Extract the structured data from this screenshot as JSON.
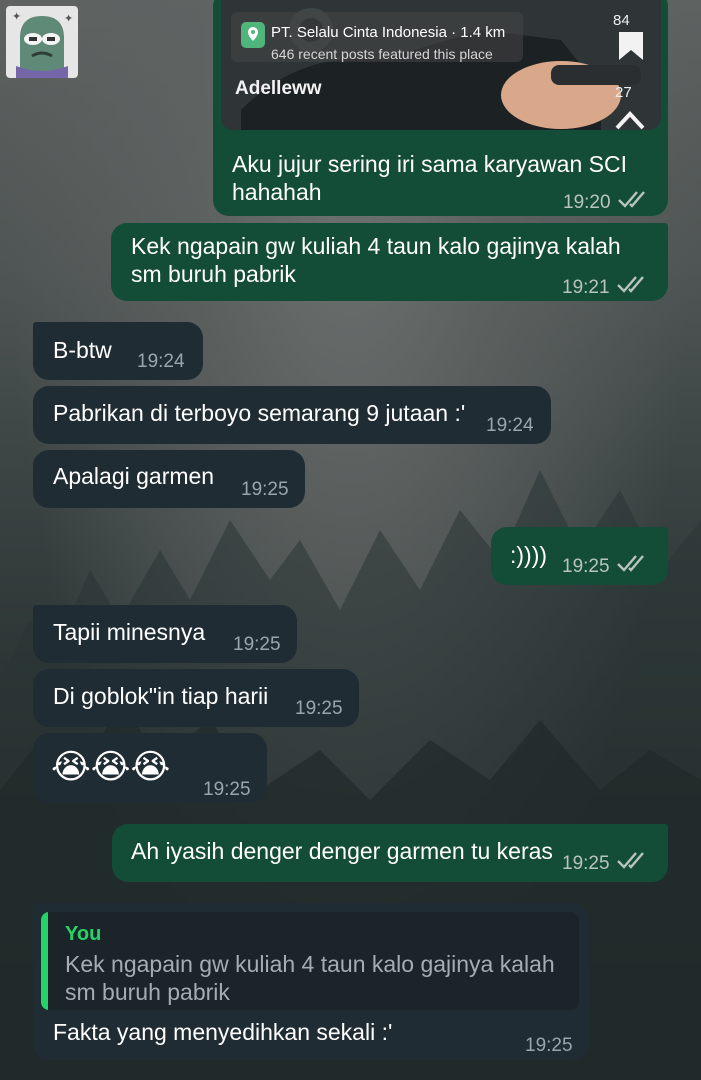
{
  "avatar": {
    "icon": "frog-sticker-icon"
  },
  "shared_post": {
    "place_name": "PT. Selalu Cinta Indonesia · 1.4 km",
    "place_sub": "646 recent posts featured this place",
    "username": "Adelleww",
    "share_count": "84",
    "save_count": "27"
  },
  "messages": [
    {
      "id": "m1",
      "direction": "out",
      "text_lines": [
        "Aku jujur sering iri sama karyawan SCI",
        "hahahah"
      ],
      "time": "19:20",
      "status": "read"
    },
    {
      "id": "m2",
      "direction": "out",
      "text_lines": [
        "Kek ngapain gw kuliah 4 taun kalo gajinya kalah",
        "sm buruh pabrik"
      ],
      "time": "19:21",
      "status": "read"
    },
    {
      "id": "m3",
      "direction": "in",
      "text": "B-btw",
      "time": "19:24"
    },
    {
      "id": "m4",
      "direction": "in",
      "text": "Pabrikan di terboyo semarang 9 jutaan :'",
      "time": "19:24"
    },
    {
      "id": "m5",
      "direction": "in",
      "text": "Apalagi garmen",
      "time": "19:25"
    },
    {
      "id": "m6",
      "direction": "out",
      "text": ":))))",
      "time": "19:25",
      "status": "read"
    },
    {
      "id": "m7",
      "direction": "in",
      "text": "Tapii minesnya",
      "time": "19:25"
    },
    {
      "id": "m8",
      "direction": "in",
      "text": "Di goblok\"in tiap harii",
      "time": "19:25"
    },
    {
      "id": "m9",
      "direction": "in",
      "text": "😭😭😭",
      "time": "19:25"
    },
    {
      "id": "m10",
      "direction": "out",
      "text": "Ah iyasih denger denger garmen tu keras",
      "time": "19:25",
      "status": "read"
    },
    {
      "id": "m11",
      "direction": "in",
      "reply_author": "You",
      "reply_lines": [
        "Kek ngapain gw kuliah 4 taun kalo gajinya kalah",
        "sm buruh pabrik"
      ],
      "text": "Fakta yang menyedihkan sekali :'",
      "time": "19:25"
    }
  ],
  "colors": {
    "outgoing_bubble": "#144d37",
    "incoming_bubble": "#202c33",
    "quote_accent": "#25d366"
  },
  "icons": {
    "read_receipt": "double-check-icon",
    "location_pin": "location-pin-icon",
    "bookmark": "bookmark-icon",
    "share": "share-arrow-icon"
  }
}
